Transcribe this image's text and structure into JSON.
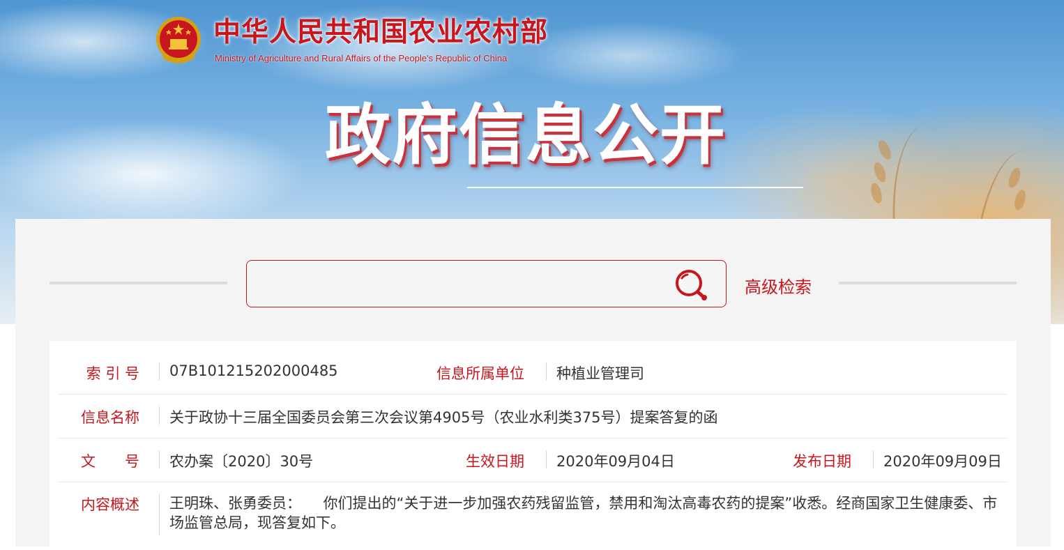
{
  "header": {
    "org_name_cn": "中华人民共和国农业农村部",
    "org_name_en": "Ministry of Agriculture and Rural Affairs of the People's Republic of China",
    "section_title": "政府信息公开"
  },
  "search": {
    "placeholder": "",
    "advanced_label": "高级检索"
  },
  "metadata": {
    "index_no_label": "索 引 号",
    "index_no": "07B101215202000485",
    "unit_label": "信息所属单位",
    "unit": "种植业管理司",
    "name_label": "信息名称",
    "name": "关于政协十三届全国委员会第三次会议第4905号（农业水利类375号）提案答复的函",
    "doc_no_label": "文　　号",
    "doc_no": "农办案〔2020〕30号",
    "effective_date_label": "生效日期",
    "effective_date": "2020年09月04日",
    "publish_date_label": "发布日期",
    "publish_date": "2020年09月09日",
    "summary_label": "内容概述",
    "summary": "王明珠、张勇委员：　　你们提出的“关于进一步加强农药残留监管，禁用和淘汰高毒农药的提案”收悉。经商国家卫生健康委、市场监管总局，现答复如下。"
  },
  "colors": {
    "accent_red": "#c8161d",
    "text": "#333333",
    "card_bg": "#f4f4f4"
  },
  "icons": {
    "emblem": "national-emblem-icon",
    "search": "search-icon"
  }
}
